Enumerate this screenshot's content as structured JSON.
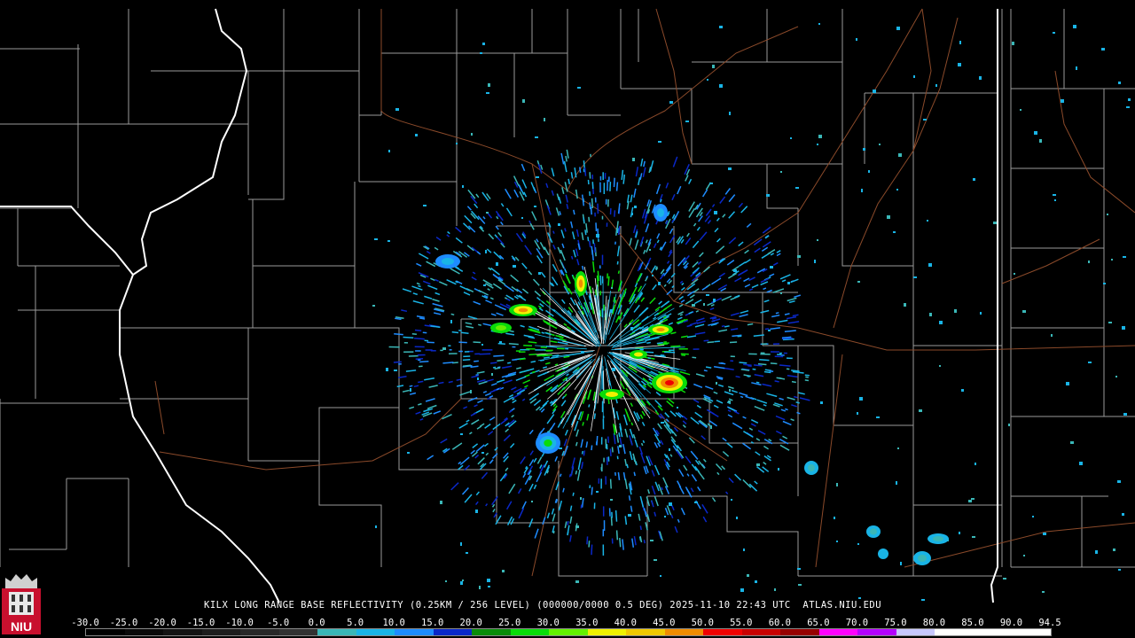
{
  "caption": {
    "station": "KILX",
    "product": "LONG RANGE BASE REFLECTIVITY (0.25KM / 256 LEVEL) (000000/0000 0.5 DEG)",
    "datetime": "2025-11-10 22:43 UTC",
    "source": "ATLAS.NIU.EDU"
  },
  "logo": {
    "text": "NIU",
    "color": "#c8102e"
  },
  "scale": {
    "labels": [
      "-30.0",
      "-25.0",
      "-20.0",
      "-15.0",
      "-10.0",
      "-5.0",
      "0.0",
      "5.0",
      "10.0",
      "15.0",
      "20.0",
      "25.0",
      "30.0",
      "35.0",
      "40.0",
      "45.0",
      "50.0",
      "55.0",
      "60.0",
      "65.0",
      "70.0",
      "75.0",
      "80.0",
      "85.0",
      "90.0",
      "94.5"
    ],
    "colors": [
      "#000000",
      "#0a0a0a",
      "#141414",
      "#1e1e1e",
      "#282828",
      "#323232",
      "#3ab7b7",
      "#19b4e6",
      "#1e8cff",
      "#0a28c8",
      "#0a8c0a",
      "#0adc0a",
      "#64f000",
      "#f0f000",
      "#f0c800",
      "#f08c00",
      "#f00000",
      "#c80000",
      "#960000",
      "#ff00ff",
      "#b400ff",
      "#c8c8ff",
      "#ffffff",
      "#ffffff",
      "#ffffff"
    ]
  },
  "colors": {
    "state_border": "#ffffff",
    "county_border": "#9a9a9a",
    "road": "#8b4a2a"
  }
}
